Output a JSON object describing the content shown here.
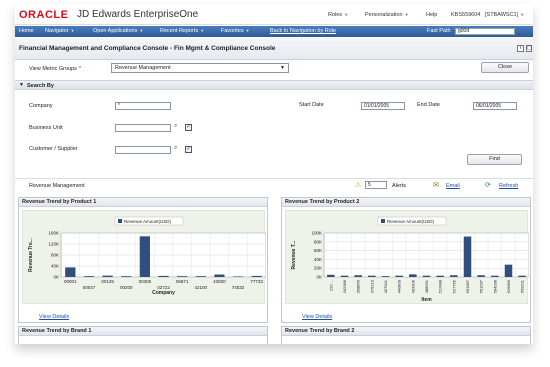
{
  "header": {
    "logo": "ORACLE",
    "product": "JD Edwards EnterpriseOne",
    "menu": [
      "Roles",
      "Personalization",
      "Help",
      "KBS559604",
      "[STBAWSC1]"
    ]
  },
  "navbar": {
    "items": [
      "Home",
      "Navigator",
      "Open Applications",
      "Recent Reports",
      "Favorites",
      "Back to Navigation by Role"
    ],
    "fast_path_label": "Fast Path",
    "fast_path_value": "g00d"
  },
  "page": {
    "title": "Financial Management and Compliance Console - Fin Mgmt & Compliance Console",
    "view_metric_groups_label": "View Metric Groups",
    "required_mark": "*",
    "metric_group_value": "Revenue Management",
    "close_label": "Close"
  },
  "search": {
    "header": "Search By",
    "company_label": "Company",
    "company_value": "*",
    "business_unit_label": "Business Unit",
    "customer_label": "Customer / Supplier",
    "start_date_label": "Start Date",
    "start_date_value": "01/01/2005",
    "end_date_label": "End Date",
    "end_date_value": "06/01/2005",
    "find_label": "Find"
  },
  "status": {
    "section": "Revenue Management",
    "alert_count": "5",
    "alerts_label": "Alerts",
    "email_label": "Email",
    "refresh_label": "Refresh"
  },
  "panels": {
    "p1_title": "Revenue Trend by Product 1",
    "p2_title": "Revenue Trend by Product 2",
    "p3_title": "Revenue Trend by Brand 1",
    "p4_title": "Revenue Trend by Brand 2",
    "view_details": "View Details"
  },
  "chart_data": [
    {
      "type": "bar",
      "legend": "Revenue Amount(USD)",
      "ylabel": "Revenue Tre...",
      "xlabel": "Company",
      "yticks": [
        "0K",
        "40K",
        "80K",
        "120K",
        "160K"
      ],
      "ylim": [
        0,
        160
      ],
      "categories": [
        "00001",
        "00047",
        "00125",
        "00200",
        "00306",
        "02722",
        "06871",
        "42100",
        "43000",
        "74532",
        "77733"
      ],
      "values": [
        35,
        3,
        5,
        3,
        148,
        4,
        3,
        3,
        9,
        2,
        4
      ]
    },
    {
      "type": "bar",
      "legend": "Revenue Amount(USD)",
      "ylabel": "Revenue T...",
      "xlabel": "Item",
      "yticks": [
        "0K",
        "20K",
        "40K",
        "60K",
        "80K",
        "100K"
      ],
      "ylim": [
        0,
        100
      ],
      "categories": [
        "220 ...",
        "342986",
        "358866",
        "375210",
        "407641",
        "440800",
        "433306",
        "488631",
        "512488",
        "527765",
        "561987",
        "561287",
        "584288",
        "626986",
        "658211"
      ],
      "values": [
        5,
        3,
        4,
        3,
        2,
        3,
        6,
        3,
        3,
        4,
        92,
        4,
        3,
        28,
        3
      ]
    }
  ]
}
